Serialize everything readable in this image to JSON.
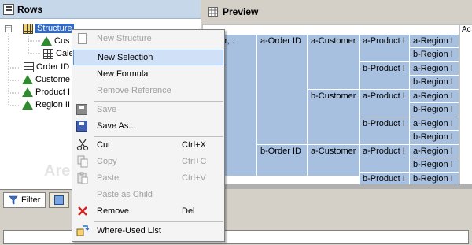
{
  "rows_panel": {
    "title": "Rows",
    "tree": [
      {
        "label": "Structure",
        "selected": true
      },
      {
        "label": "Cus"
      },
      {
        "label": "Cale"
      },
      {
        "label": "Order ID"
      },
      {
        "label": "Custome"
      },
      {
        "label": "Product I"
      },
      {
        "label": "Region II"
      }
    ],
    "watermark": "Are"
  },
  "tabs": [
    {
      "label": "Filter"
    }
  ],
  "preview": {
    "title": "Preview",
    "col_header": "Ac",
    "cells": {
      "c1": "tomer, .",
      "a_order": "a-Order ID",
      "b_order": "b-Order ID",
      "a_customer": "a-Customer",
      "b_customer": "b-Customer",
      "a_customer2": "a-Customer",
      "a_product": "a-Product I",
      "b_product": "b-Product I",
      "a_region": "a-Region I",
      "b_region": "b-Region I"
    }
  },
  "context_menu": {
    "new_structure": "New Structure",
    "new_selection": "New Selection",
    "new_formula": "New Formula",
    "remove_reference": "Remove Reference",
    "save": "Save",
    "save_as": "Save As...",
    "cut": "Cut",
    "cut_shortcut": "Ctrl+X",
    "copy": "Copy",
    "copy_shortcut": "Ctrl+C",
    "paste": "Paste",
    "paste_shortcut": "Ctrl+V",
    "paste_as_child": "Paste as Child",
    "remove": "Remove",
    "remove_shortcut": "Del",
    "where_used": "Where-Used List"
  }
}
